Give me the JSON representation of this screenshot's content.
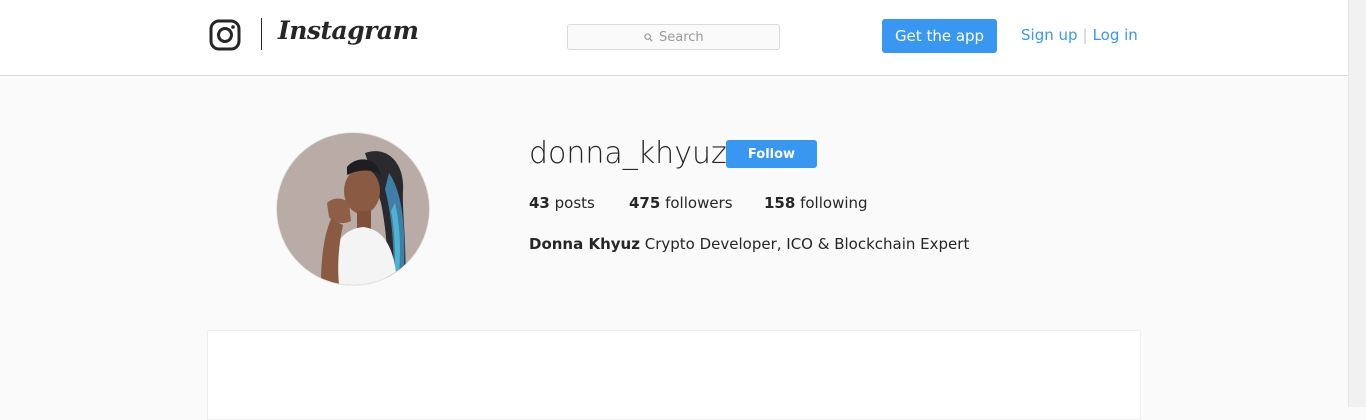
{
  "header": {
    "logo_icon": "instagram-camera-icon",
    "wordmark": "Instagram",
    "search": {
      "placeholder": "Search",
      "icon": "search-icon"
    },
    "get_app_label": "Get the app",
    "signup_label": "Sign up",
    "separator": "|",
    "login_label": "Log in"
  },
  "profile": {
    "username": "donna_khyuz",
    "follow_label": "Follow",
    "stats": {
      "posts_count": "43",
      "posts_label": "posts",
      "followers_count": "475",
      "followers_label": "followers",
      "following_count": "158",
      "following_label": "following"
    },
    "full_name": "Donna Khyuz",
    "bio": "Crypto Developer, ICO & Blockchain Expert"
  },
  "colors": {
    "accent": "#3897f0",
    "background": "#fafafa",
    "text": "#262626"
  }
}
